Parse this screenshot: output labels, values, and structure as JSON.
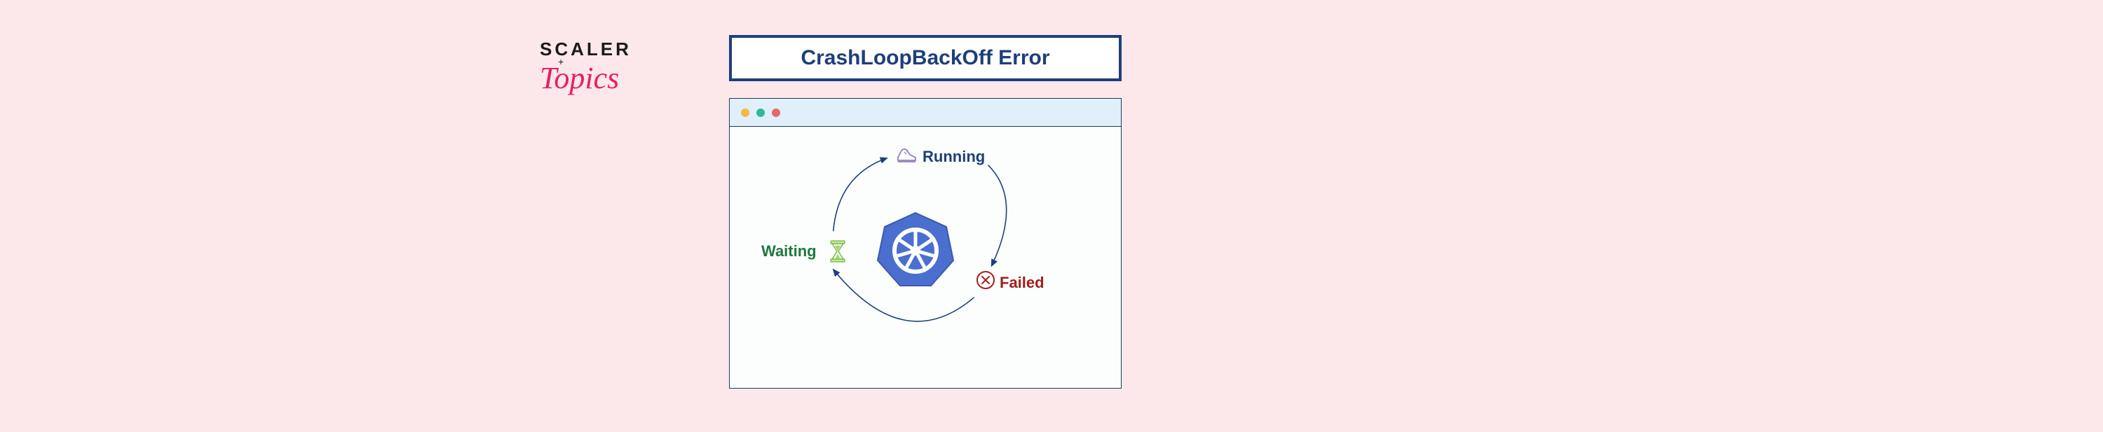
{
  "brand": {
    "line1": "SCALER",
    "plus": "+",
    "line2": "Topics"
  },
  "title": "CrashLoopBackOff Error",
  "diagram": {
    "states": {
      "running": "Running",
      "failed": "Failed",
      "waiting": "Waiting"
    },
    "icons": {
      "running": "shoe-icon",
      "failed": "x-circle-icon",
      "waiting": "hourglass-icon",
      "center": "kubernetes-logo"
    },
    "cycle": [
      "Waiting",
      "Running",
      "Failed"
    ],
    "colors": {
      "running": "#1d3f7a",
      "failed": "#a31d1d",
      "waiting": "#1c7a3c",
      "accent": "#4a6fcf"
    }
  },
  "window": {
    "dots": [
      "yellow",
      "teal",
      "red"
    ]
  }
}
